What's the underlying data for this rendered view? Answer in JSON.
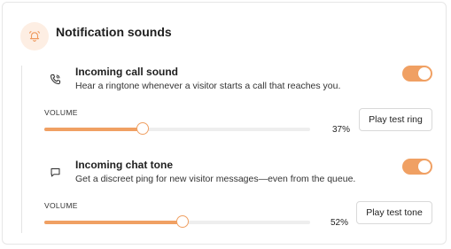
{
  "section": {
    "title": "Notification sounds",
    "icon": "bell-icon",
    "accent": "#f0a063"
  },
  "settings": [
    {
      "label": "Incoming call sound",
      "description": "Hear a ringtone whenever a visitor starts a call that reaches you.",
      "icon": "phone-icon",
      "enabled": true,
      "volume_label": "VOLUME",
      "volume": 37,
      "volume_text": "37%",
      "button_label": "Play test ring"
    },
    {
      "label": "Incoming chat tone",
      "description": "Get a discreet ping for new visitor messages—even from the queue.",
      "icon": "chat-icon",
      "enabled": true,
      "volume_label": "VOLUME",
      "volume": 52,
      "volume_text": "52%",
      "button_label": "Play test tone"
    }
  ]
}
